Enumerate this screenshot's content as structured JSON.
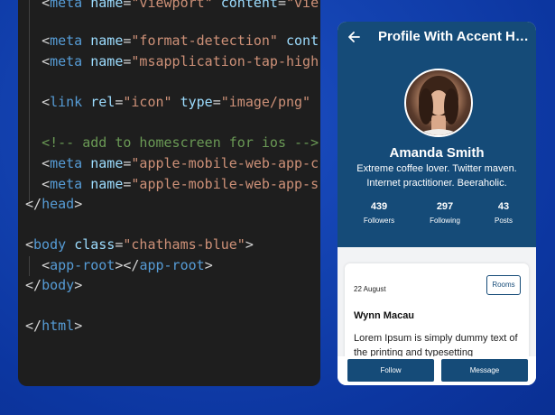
{
  "code": {
    "l1": {
      "open": "<",
      "tag": "meta",
      "attr": "name",
      "eq": "=",
      "val": "\"viewport\"",
      "sp": " ",
      "attr2": "content",
      "eq2": "=",
      "val2": "\"vie"
    },
    "l2": {
      "open": "<",
      "tag": "meta",
      "attr": "name",
      "eq": "=",
      "val": "\"format-detection\"",
      "sp": " ",
      "attr2": "cont"
    },
    "l3": {
      "open": "<",
      "tag": "meta",
      "attr": "name",
      "eq": "=",
      "val": "\"msapplication-tap-high"
    },
    "l4": {
      "open": "<",
      "tag": "link",
      "attr": "rel",
      "eq": "=",
      "val": "\"icon\"",
      "sp": " ",
      "attr2": "type",
      "eq2": "=",
      "val2": "\"image/png\""
    },
    "l5": {
      "comment": "<!-- add to homescreen for ios -->"
    },
    "l6": {
      "open": "<",
      "tag": "meta",
      "attr": "name",
      "eq": "=",
      "val": "\"apple-mobile-web-app-c"
    },
    "l7": {
      "open": "<",
      "tag": "meta",
      "attr": "name",
      "eq": "=",
      "val": "\"apple-mobile-web-app-s"
    },
    "l8": {
      "open": "</",
      "tag": "head",
      "close": ">"
    },
    "l9": {
      "open": "<",
      "tag": "body",
      "attr": "class",
      "eq": "=",
      "val": "\"chathams-blue\"",
      "close": ">"
    },
    "l10": {
      "open": "<",
      "tag": "app-root",
      "mid": "></",
      "tag2": "app-root",
      "close": ">"
    },
    "l11": {
      "open": "</",
      "tag": "body",
      "close": ">"
    },
    "l12": {
      "open": "</",
      "tag": "html",
      "close": ">"
    }
  },
  "profile": {
    "title": "Profile With Accent Header",
    "name": "Amanda Smith",
    "bio_line1": "Extreme coffee lover. Twitter maven.",
    "bio_line2": "Internet practitioner. Beeraholic.",
    "stats": [
      {
        "value": "439",
        "label": "Followers"
      },
      {
        "value": "297",
        "label": "Following"
      },
      {
        "value": "43",
        "label": "Posts"
      }
    ],
    "card": {
      "date": "22 August",
      "rooms_label": "Rooms",
      "title": "Wynn Macau",
      "text": "Lorem Ipsum is simply dummy text of the printing and typesetting"
    },
    "follow_label": "Follow",
    "message_label": "Message"
  },
  "colors": {
    "accent": "#154b78",
    "editor_bg": "#1e1e1e",
    "background": "#1342b0"
  },
  "icons": {
    "back": "arrow-left-icon"
  }
}
